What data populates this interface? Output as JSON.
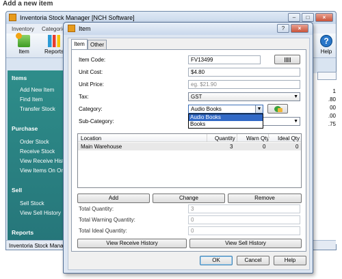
{
  "page": {
    "heading": "Add a new item"
  },
  "bg_window": {
    "title": "Inventoria Stock Manager [NCH Software]",
    "menu": [
      "Inventory",
      "Categorie"
    ],
    "toolbar": {
      "item": "Item",
      "reports": "Reports",
      "help": "Help",
      "help_glyph": "?"
    },
    "sidebar": {
      "items_head": "Items",
      "items": [
        "Add New Item",
        "Find Item",
        "Transfer Stock"
      ],
      "purchase_head": "Purchase",
      "purchase": [
        "Order Stock",
        "Receive Stock",
        "View Receive Histo",
        "View Items On Ord"
      ],
      "sell_head": "Sell",
      "sell": [
        "Sell Stock",
        "View Sell History"
      ],
      "reports_head": "Reports"
    },
    "right_values": [
      "1",
      ".80",
      "00",
      ".00",
      ".75"
    ],
    "status": "Inventoria Stock Mana",
    "win_buttons": {
      "minimize": "–",
      "maximize": "□",
      "close": "×"
    }
  },
  "dialog": {
    "title": "Item",
    "win_buttons": {
      "help": "?",
      "close": "×"
    },
    "tabs": [
      "Item",
      "Other"
    ],
    "labels": {
      "item_code": "Item Code:",
      "unit_cost": "Unit Cost:",
      "unit_price": "Unit Price:",
      "tax": "Tax:",
      "category": "Category:",
      "sub_category": "Sub-Category:",
      "total_quantity": "Total Quantity:",
      "total_warning": "Total Warning Quantity:",
      "total_ideal": "Total Ideal Quantity:"
    },
    "values": {
      "item_code": "FV13499",
      "unit_cost": "$4.80",
      "unit_price_placeholder": "eg. $21.90",
      "tax": "GST",
      "category": "Audio Books",
      "total_quantity": "3",
      "total_warning": "0",
      "total_ideal": "0"
    },
    "category_options": [
      "Audio Books",
      "Books"
    ],
    "table": {
      "columns": [
        "Location",
        "Quantity",
        "Warn Qty",
        "Ideal Qty"
      ],
      "rows": [
        {
          "location": "Main Warehouse",
          "quantity": "3",
          "warn": "0",
          "ideal": "0"
        }
      ]
    },
    "buttons": {
      "add": "Add",
      "change": "Change",
      "remove": "Remove",
      "view_receive_history": "View Receive History",
      "view_sell_history": "View Sell History",
      "ok": "OK",
      "cancel": "Cancel",
      "help": "Help"
    },
    "glyphs": {
      "dropdown_arrow": "▼"
    }
  }
}
